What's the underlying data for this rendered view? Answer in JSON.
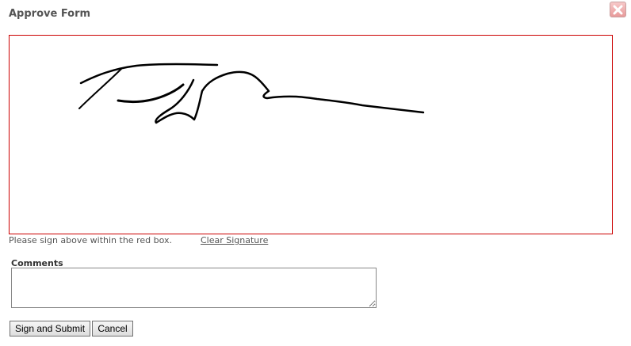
{
  "dialog": {
    "title": "Approve Form",
    "close_icon": "close-icon"
  },
  "signature": {
    "border_color": "#cc0000",
    "hint": "Please sign above within the red box.",
    "clear_label": "Clear Signature"
  },
  "comments": {
    "label": "Comments",
    "value": ""
  },
  "actions": {
    "submit_label": "Sign and Submit",
    "cancel_label": "Cancel"
  }
}
